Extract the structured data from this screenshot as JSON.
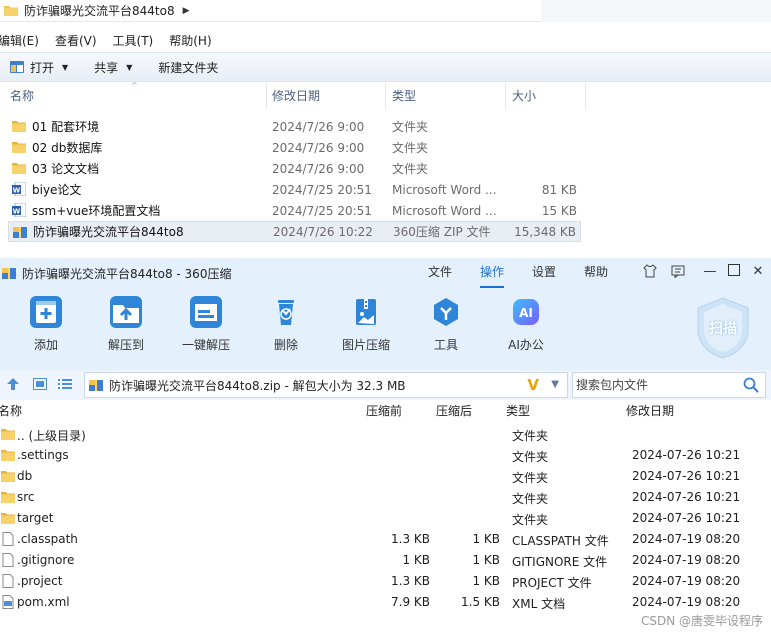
{
  "explorer": {
    "path": "防诈骗曝光交流平台844to8",
    "menu": [
      "编辑(E)",
      "查看(V)",
      "工具(T)",
      "帮助(H)"
    ],
    "commands": {
      "open": "打开",
      "share": "共享",
      "new_folder": "新建文件夹"
    },
    "columns": {
      "name": "名称",
      "date": "修改日期",
      "type": "类型",
      "size": "大小"
    },
    "files": [
      {
        "name": "01 配套环境",
        "date": "2024/7/26 9:00",
        "type": "文件夹",
        "size": "",
        "icon": "folder-icon"
      },
      {
        "name": "02 db数据库",
        "date": "2024/7/26 9:00",
        "type": "文件夹",
        "size": "",
        "icon": "folder-icon"
      },
      {
        "name": "03 论文文档",
        "date": "2024/7/26 9:00",
        "type": "文件夹",
        "size": "",
        "icon": "folder-icon"
      },
      {
        "name": "biye论文",
        "date": "2024/7/25 20:51",
        "type": "Microsoft Word ...",
        "size": "81 KB",
        "icon": "word-doc-icon"
      },
      {
        "name": "ssm+vue环境配置文档",
        "date": "2024/7/25 20:51",
        "type": "Microsoft Word ...",
        "size": "15 KB",
        "icon": "word-doc-icon"
      },
      {
        "name": "防诈骗曝光交流平台844to8",
        "date": "2024/7/26 10:22",
        "type": "360压缩 ZIP 文件",
        "size": "15,348 KB",
        "icon": "zip-archive-icon",
        "selected": true
      }
    ]
  },
  "zip": {
    "title": "防诈骗曝光交流平台844to8 - 360压缩",
    "menu": {
      "file": "文件",
      "operate": "操作",
      "settings": "设置",
      "help": "帮助"
    },
    "toolbar": [
      {
        "label": "添加",
        "icon": "add-icon"
      },
      {
        "label": "解压到",
        "icon": "extract-to-icon"
      },
      {
        "label": "一键解压",
        "icon": "one-click-extract-icon"
      },
      {
        "label": "删除",
        "icon": "delete-icon"
      },
      {
        "label": "图片压缩",
        "icon": "image-compress-icon"
      },
      {
        "label": "工具",
        "icon": "tools-icon"
      },
      {
        "label": "AI办公",
        "icon": "ai-office-icon"
      }
    ],
    "scan_label": "扫描",
    "archive_path": "防诈骗曝光交流平台844to8.zip - 解包大小为 32.3 MB",
    "search_placeholder": "搜索包内文件",
    "columns": {
      "name": "名称",
      "before": "压缩前",
      "after": "压缩后",
      "type": "类型",
      "modified": "修改日期"
    },
    "rows": [
      {
        "name": ".. (上级目录)",
        "before": "",
        "after": "",
        "type": "文件夹",
        "modified": "",
        "icon": "folder-icon"
      },
      {
        "name": ".settings",
        "before": "",
        "after": "",
        "type": "文件夹",
        "modified": "2024-07-26 10:21",
        "icon": "folder-icon"
      },
      {
        "name": "db",
        "before": "",
        "after": "",
        "type": "文件夹",
        "modified": "2024-07-26 10:21",
        "icon": "folder-icon"
      },
      {
        "name": "src",
        "before": "",
        "after": "",
        "type": "文件夹",
        "modified": "2024-07-26 10:21",
        "icon": "folder-icon"
      },
      {
        "name": "target",
        "before": "",
        "after": "",
        "type": "文件夹",
        "modified": "2024-07-26 10:21",
        "icon": "folder-icon"
      },
      {
        "name": ".classpath",
        "before": "1.3 KB",
        "after": "1 KB",
        "type": "CLASSPATH 文件",
        "modified": "2024-07-19 08:20",
        "icon": "file-icon"
      },
      {
        "name": ".gitignore",
        "before": "1 KB",
        "after": "1 KB",
        "type": "GITIGNORE 文件",
        "modified": "2024-07-19 08:20",
        "icon": "file-icon"
      },
      {
        "name": ".project",
        "before": "1.3 KB",
        "after": "1 KB",
        "type": "PROJECT 文件",
        "modified": "2024-07-19 08:20",
        "icon": "file-icon"
      },
      {
        "name": "pom.xml",
        "before": "7.9 KB",
        "after": "1.5 KB",
        "type": "XML 文档",
        "modified": "2024-07-19 08:20",
        "icon": "xml-file-icon"
      }
    ]
  },
  "watermark": "CSDN @唐雯毕设程序"
}
